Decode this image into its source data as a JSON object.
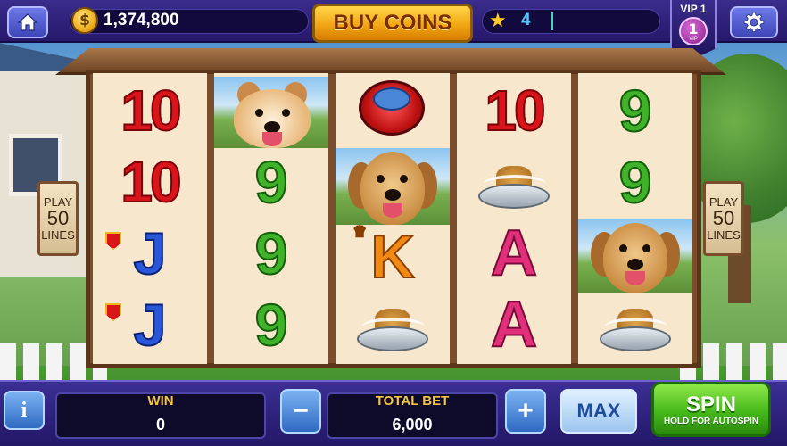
{
  "topbar": {
    "coins": "1,374,800",
    "coin_symbol": "$",
    "buy_coins_label": "BUY COINS",
    "level": "4",
    "level_progress": 0.02,
    "vip_label": "VIP 1",
    "vip_number": "1",
    "vip_small": "VIP"
  },
  "reels": [
    [
      "10",
      "10",
      "J",
      "J"
    ],
    [
      "pomeranian-dog",
      "9",
      "9",
      "9"
    ],
    [
      "frisbee",
      "golden-retriever-dog",
      "K",
      "dog-bowl"
    ],
    [
      "10",
      "dog-bowl",
      "A",
      "A"
    ],
    [
      "9",
      "9",
      "golden-retriever-dog",
      "dog-bowl"
    ]
  ],
  "lines_left": {
    "top": "PLAY",
    "num": "50",
    "bottom": "LINES"
  },
  "lines_right": {
    "top": "PLAY",
    "num": "50",
    "bottom": "LINES"
  },
  "bottombar": {
    "info_label": "i",
    "win_label": "WIN",
    "win_value": "0",
    "minus_label": "−",
    "total_bet_label": "TOTAL BET",
    "total_bet_value": "6,000",
    "plus_label": "+",
    "max_label": "MAX",
    "spin_label": "SPIN",
    "spin_sub": "HOLD FOR AUTOSPIN"
  },
  "colors": {
    "topbar": "#2c1f7a",
    "buy_button": "#f2a615",
    "spin_button": "#45b81a",
    "panel_label": "#f6c544"
  }
}
